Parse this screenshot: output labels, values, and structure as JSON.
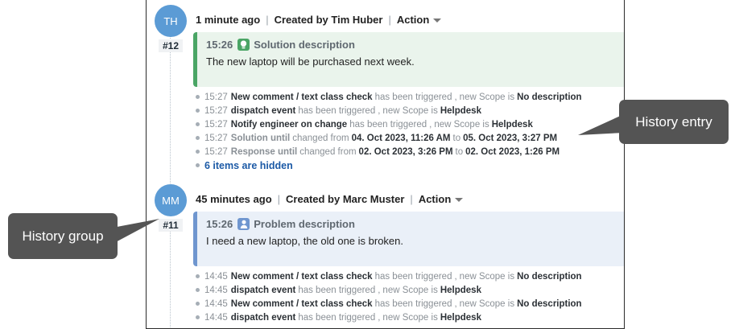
{
  "groups": [
    {
      "avatar": "TH",
      "ticket": "#12",
      "when": "1 minute ago",
      "created_by": "Created by Tim Huber",
      "action": "Action",
      "card": {
        "time": "15:26",
        "title": "Solution description",
        "text": "The new laptop will be purchased next week.",
        "icon": "lightbulb-icon",
        "accent": "#4aa565"
      },
      "entries": [
        {
          "time": "15:27",
          "subject": "New comment / text class check",
          "verb": "has been triggered",
          "sep": ",",
          "extra": "new Scope is",
          "value": "No description"
        },
        {
          "time": "15:27",
          "subject": "dispatch event",
          "verb": "has been triggered",
          "sep": ",",
          "extra": "new Scope is",
          "value": "Helpdesk"
        },
        {
          "time": "15:27",
          "subject": "Notify engineer on change",
          "verb": "has been triggered",
          "sep": ",",
          "extra": "new Scope is",
          "value": "Helpdesk"
        },
        {
          "time": "15:27",
          "subject": "Solution until",
          "verb": "changed from",
          "sep": "",
          "extra": "",
          "value": "04. Oct 2023, 11:26 AM",
          "to": "to",
          "value2": "05. Oct 2023, 3:27 PM"
        },
        {
          "time": "15:27",
          "subject": "Response until",
          "verb": "changed from",
          "sep": "",
          "extra": "",
          "value": "02. Oct 2023, 3:26 PM",
          "to": "to",
          "value2": "02. Oct 2023, 1:26 PM"
        }
      ],
      "hidden_link": "6 items are hidden"
    },
    {
      "avatar": "MM",
      "ticket": "#11",
      "when": "45 minutes ago",
      "created_by": "Created by Marc Muster",
      "action": "Action",
      "card": {
        "time": "15:26",
        "title": "Problem description",
        "text": "I need a new laptop, the old one is broken.",
        "icon": "person-icon",
        "accent": "#6f96cf"
      },
      "entries": [
        {
          "time": "14:45",
          "subject": "New comment / text class check",
          "verb": "has been triggered",
          "sep": ",",
          "extra": "new Scope is",
          "value": "No description"
        },
        {
          "time": "14:45",
          "subject": "dispatch event",
          "verb": "has been triggered",
          "sep": ",",
          "extra": "new Scope is",
          "value": "Helpdesk"
        },
        {
          "time": "14:45",
          "subject": "New comment / text class check",
          "verb": "has been triggered",
          "sep": ",",
          "extra": "new Scope is",
          "value": "No description"
        },
        {
          "time": "14:45",
          "subject": "dispatch event",
          "verb": "has been triggered",
          "sep": ",",
          "extra": "new Scope is",
          "value": "Helpdesk"
        }
      ]
    }
  ],
  "callouts": {
    "history_entry": "History entry",
    "history_group": "History group"
  },
  "colors": {
    "avatar": "#5b9bd5",
    "callout": "#545454",
    "link": "#1c5aa6"
  }
}
